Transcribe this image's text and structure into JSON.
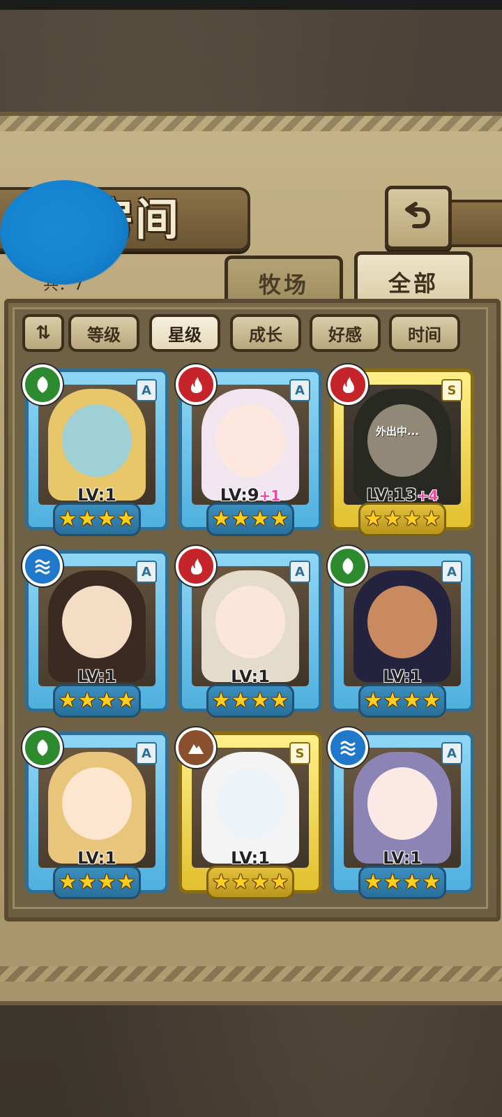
{
  "header": {
    "title": "房间",
    "count_label": "共：7",
    "back_icon": "return-arrow-icon"
  },
  "tabs": [
    {
      "label": "牧场",
      "active": false
    },
    {
      "label": "全部",
      "active": true
    }
  ],
  "sort": {
    "toggle_label": "⇅",
    "options": [
      {
        "label": "等级",
        "active": false
      },
      {
        "label": "星级",
        "active": true
      },
      {
        "label": "成长",
        "active": false
      },
      {
        "label": "好感",
        "active": false
      },
      {
        "label": "时间",
        "active": false
      }
    ]
  },
  "cards": [
    {
      "element": "leaf",
      "rank": "A",
      "level": "LV:1",
      "bonus": "",
      "stars": 4,
      "frame": "blue",
      "status": "",
      "hair": "#e8c66a",
      "skin": "#9fd0d6"
    },
    {
      "element": "fire",
      "rank": "A",
      "level": "LV:9",
      "bonus": "+1",
      "stars": 4,
      "frame": "blue",
      "status": "",
      "hair": "#f1e6ef",
      "skin": "#fde7df"
    },
    {
      "element": "fire",
      "rank": "S",
      "level": "LV:13",
      "bonus": "+4",
      "stars": 4,
      "frame": "gold",
      "status": "外出中...",
      "hair": "#3b3b2e",
      "skin": "#d9c29b"
    },
    {
      "element": "water",
      "rank": "A",
      "level": "LV:1",
      "bonus": "",
      "stars": 4,
      "frame": "blue",
      "status": "",
      "hair": "#3a2a22",
      "skin": "#f5dcc4"
    },
    {
      "element": "fire",
      "rank": "A",
      "level": "LV:1",
      "bonus": "",
      "stars": 4,
      "frame": "blue",
      "status": "",
      "hair": "#e4dccb",
      "skin": "#fbe6da"
    },
    {
      "element": "leaf",
      "rank": "A",
      "level": "LV:1",
      "bonus": "",
      "stars": 4,
      "frame": "blue",
      "status": "",
      "hair": "#23233f",
      "skin": "#c88a5e"
    },
    {
      "element": "leaf",
      "rank": "A",
      "level": "LV:1",
      "bonus": "",
      "stars": 4,
      "frame": "blue",
      "status": "",
      "hair": "#e9c57c",
      "skin": "#fde6cf"
    },
    {
      "element": "earth",
      "rank": "S",
      "level": "LV:1",
      "bonus": "",
      "stars": 4,
      "frame": "gold",
      "status": "",
      "hair": "#f4f4f4",
      "skin": "#eef3f7"
    },
    {
      "element": "water",
      "rank": "A",
      "level": "LV:1",
      "bonus": "",
      "stars": 4,
      "frame": "blue",
      "status": "",
      "hair": "#8b84b4",
      "skin": "#fbe9e6"
    }
  ],
  "colors": {
    "leaf": "#2e8a2f",
    "fire": "#c6242b",
    "water": "#1f78c9",
    "earth": "#8a4f2c"
  }
}
